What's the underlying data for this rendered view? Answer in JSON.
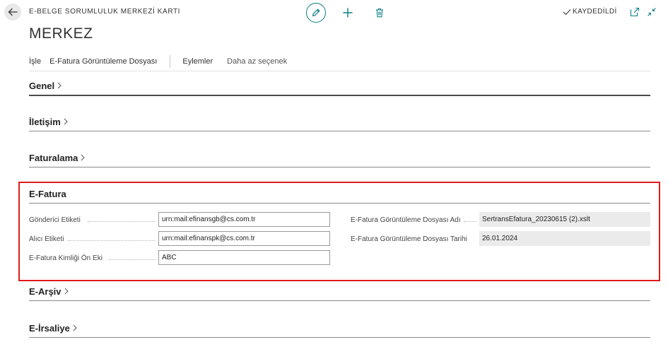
{
  "header": {
    "caption": "E-BELGE SORUMLULUK MERKEZİ KARTI",
    "title": "MERKEZ",
    "saved_status": "KAYDEDİLDİ"
  },
  "icons": {
    "back": "arrow-left-icon",
    "edit": "pencil-icon",
    "add": "plus-icon",
    "delete": "trash-icon",
    "saved": "checkmark-icon",
    "open_new": "open-in-new-window-icon",
    "collapse": "collapse-icon"
  },
  "colors": {
    "accent": "#0a7d85",
    "highlight_border": "#e01b1b",
    "readonly_bg": "#ebebeb"
  },
  "actions": {
    "process": "İşle",
    "efatura_view_file": "E-Fatura Görüntüleme Dosyası",
    "actions": "Eylemler",
    "fewer_options": "Daha az seçenek"
  },
  "sections": {
    "genel": "Genel",
    "iletisim": "İletişim",
    "faturalama": "Faturalama",
    "efatura": "E-Fatura",
    "earsiv": "E-Arşiv",
    "eirsaliye": "E-İrsaliye"
  },
  "efatura": {
    "sender_label": {
      "label": "Gönderici Etiketi",
      "value": "urn:mail:efinansgb@cs.com.tr"
    },
    "receiver_label": {
      "label": "Alıcı Etiketi",
      "value": "urn:mail:efinanspk@cs.com.tr"
    },
    "id_prefix": {
      "label": "E-Fatura Kimliği Ön Eki",
      "value": "ABC"
    },
    "view_file_name": {
      "label": "E-Fatura Görüntüleme Dosyası Adı",
      "value": "SertransEfatura_20230615 (2).xslt"
    },
    "view_file_date": {
      "label": "E-Fatura Görüntüleme Dosyası Tarihi",
      "value": "26.01.2024"
    }
  }
}
